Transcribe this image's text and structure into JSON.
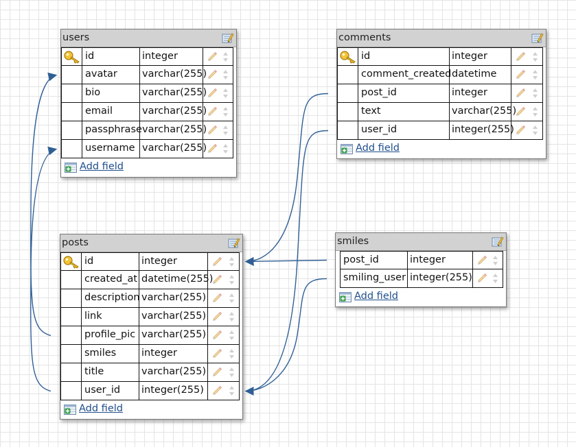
{
  "tables": [
    {
      "id": "users",
      "name": "users",
      "add_field_label": "Add field",
      "fields": [
        {
          "name": "id",
          "type": "integer",
          "primary_key": true
        },
        {
          "name": "avatar",
          "type": "varchar(255)"
        },
        {
          "name": "bio",
          "type": "varchar(255)"
        },
        {
          "name": "email",
          "type": "varchar(255)"
        },
        {
          "name": "passphrase",
          "type": "varchar(255)"
        },
        {
          "name": "username",
          "type": "varchar(255)"
        }
      ]
    },
    {
      "id": "comments",
      "name": "comments",
      "add_field_label": "Add field",
      "fields": [
        {
          "name": "id",
          "type": "integer",
          "primary_key": true
        },
        {
          "name": "comment_created",
          "type": "datetime"
        },
        {
          "name": "post_id",
          "type": "integer"
        },
        {
          "name": "text",
          "type": "varchar(255)"
        },
        {
          "name": "user_id",
          "type": "integer(255)"
        }
      ]
    },
    {
      "id": "posts",
      "name": "posts",
      "add_field_label": "Add field",
      "fields": [
        {
          "name": "id",
          "type": "integer",
          "primary_key": true
        },
        {
          "name": "created_at",
          "type": "datetime(255)"
        },
        {
          "name": "description",
          "type": "varchar(255)"
        },
        {
          "name": "link",
          "type": "varchar(255)"
        },
        {
          "name": "profile_pic",
          "type": "varchar(255)"
        },
        {
          "name": "smiles",
          "type": "integer"
        },
        {
          "name": "title",
          "type": "varchar(255)"
        },
        {
          "name": "user_id",
          "type": "integer(255)"
        }
      ]
    },
    {
      "id": "smiles",
      "name": "smiles",
      "add_field_label": "Add field",
      "fields": [
        {
          "name": "post_id",
          "type": "integer"
        },
        {
          "name": "smiling_user",
          "type": "integer(255)"
        }
      ]
    }
  ],
  "relations": [
    {
      "from": "comments.post_id",
      "to": "posts.id"
    },
    {
      "from": "comments.user_id",
      "to": "posts.user_id"
    },
    {
      "from": "smiles.post_id",
      "to": "posts.id"
    },
    {
      "from": "smiles.smiling_user",
      "to": "posts.user_id"
    },
    {
      "from": "posts.profile_pic",
      "to": "users.avatar"
    },
    {
      "from": "posts.user_id",
      "to": "users.username"
    }
  ],
  "colors": {
    "link": "#1f4e8c",
    "connector": "#2f5f95",
    "header": "#d2d2d2",
    "grid": "#e4e4e4"
  },
  "icons": {
    "primary_key": "key-icon",
    "edit_table": "edit-table-icon",
    "edit_field": "pencil-icon",
    "reorder": "reorder-arrows-icon",
    "add_field": "add-field-icon"
  }
}
